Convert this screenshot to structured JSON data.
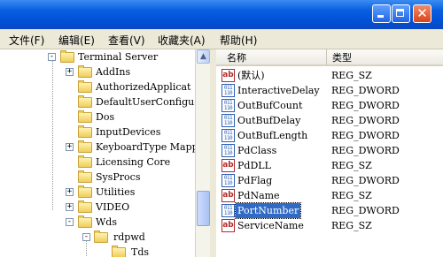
{
  "window": {
    "close_glyph": "✕"
  },
  "menu": [
    {
      "label": "文件(F)"
    },
    {
      "label": "编辑(E)"
    },
    {
      "label": "查看(V)"
    },
    {
      "label": "收藏夹(A)"
    },
    {
      "label": "帮助(H)"
    }
  ],
  "tree": {
    "nodes": [
      {
        "label": "Terminal Server",
        "expander": "-"
      },
      {
        "label": "AddIns",
        "expander": "+"
      },
      {
        "label": "AuthorizedApplicat",
        "expander": ""
      },
      {
        "label": "DefaultUserConfigu",
        "expander": ""
      },
      {
        "label": "Dos",
        "expander": ""
      },
      {
        "label": "InputDevices",
        "expander": ""
      },
      {
        "label": "KeyboardType Mappi",
        "expander": "+"
      },
      {
        "label": "Licensing Core",
        "expander": ""
      },
      {
        "label": "SysProcs",
        "expander": ""
      },
      {
        "label": "Utilities",
        "expander": "+"
      },
      {
        "label": "VIDEO",
        "expander": "+"
      },
      {
        "label": "Wds",
        "expander": "-"
      },
      {
        "label": "rdpwd",
        "expander": "-"
      },
      {
        "label": "Tds",
        "expander": ""
      }
    ]
  },
  "values": {
    "headers": {
      "name": "名称",
      "type": "类型"
    },
    "rows": [
      {
        "name": "(默认)",
        "type": "REG_SZ",
        "icon": "string-value-icon",
        "icon_text": "ab",
        "selected": false
      },
      {
        "name": "InteractiveDelay",
        "type": "REG_DWORD",
        "icon": "binary-value-icon",
        "icon_text": "011\n110",
        "selected": false
      },
      {
        "name": "OutBufCount",
        "type": "REG_DWORD",
        "icon": "binary-value-icon",
        "icon_text": "011\n110",
        "selected": false
      },
      {
        "name": "OutBufDelay",
        "type": "REG_DWORD",
        "icon": "binary-value-icon",
        "icon_text": "011\n110",
        "selected": false
      },
      {
        "name": "OutBufLength",
        "type": "REG_DWORD",
        "icon": "binary-value-icon",
        "icon_text": "011\n110",
        "selected": false
      },
      {
        "name": "PdClass",
        "type": "REG_DWORD",
        "icon": "binary-value-icon",
        "icon_text": "011\n110",
        "selected": false
      },
      {
        "name": "PdDLL",
        "type": "REG_SZ",
        "icon": "string-value-icon",
        "icon_text": "ab",
        "selected": false
      },
      {
        "name": "PdFlag",
        "type": "REG_DWORD",
        "icon": "binary-value-icon",
        "icon_text": "011\n110",
        "selected": false
      },
      {
        "name": "PdName",
        "type": "REG_SZ",
        "icon": "string-value-icon",
        "icon_text": "ab",
        "selected": false
      },
      {
        "name": "PortNumber",
        "type": "REG_DWORD",
        "icon": "binary-value-icon",
        "icon_text": "011\n110",
        "selected": true
      },
      {
        "name": "ServiceName",
        "type": "REG_SZ",
        "icon": "string-value-icon",
        "icon_text": "ab",
        "selected": false
      }
    ]
  },
  "colors": {
    "titlebar": "#0a5fe0",
    "selection": "#316ac5",
    "menubar": "#ece9d8"
  }
}
